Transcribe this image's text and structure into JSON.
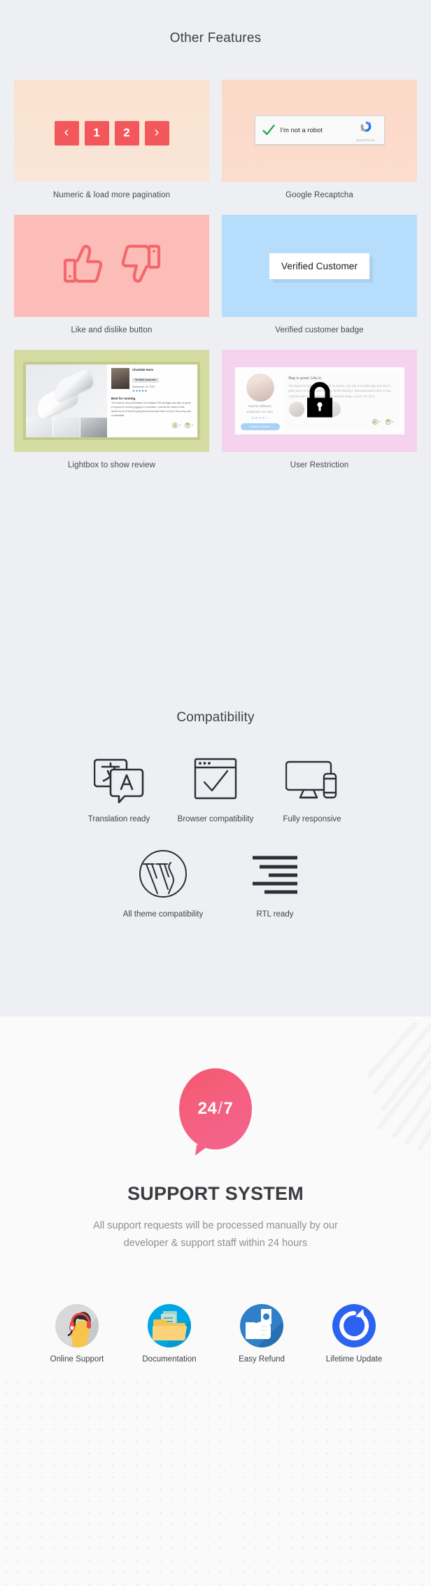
{
  "features": {
    "title": "Other Features",
    "cards": [
      {
        "caption": "Numeric & load more pagination",
        "art": "pagination",
        "pager": [
          "‹",
          "1",
          "2",
          "›"
        ]
      },
      {
        "caption": "Google Recaptcha",
        "art": "recaptcha",
        "recaptcha_label": "I'm not a robot",
        "recaptcha_brand": "reCAPTCHA"
      },
      {
        "caption": "Like and dislike button",
        "art": "like-dislike"
      },
      {
        "caption": "Verified customer badge",
        "art": "verified-badge",
        "badge_text": "Verified Customer"
      },
      {
        "caption": "Lightbox to show review",
        "art": "lightbox",
        "review": {
          "name": "Charlotte Haris",
          "badge": "Verified customer",
          "date": "September 19, 2021",
          "stars": "★★★★★",
          "title": "Best for running",
          "text": "The shoe is very comfortable and elegant.The package was also so good. It is good for running jogging or excercise. Love all the shoes of this brand.Go for it.Worth buying.Recommended other to buy.It Very cosy and comfortable.",
          "like_count": "0",
          "dislike_count": "0"
        }
      },
      {
        "caption": "User Restriction",
        "art": "user-restriction",
        "review": {
          "name": "Rachel Williams",
          "date": "September 19, 2021",
          "stars": "★★★★☆",
          "badge": "Verified customer",
          "title": "Bag is good. Like it.",
          "text": "The bag is so handy and looks is so classic, can use it occasionally and also in party too. It is so soft and elegant. Worth buying it. Recommended other to buy. Just buy one of the best product in internet today. Love it. Go for it.",
          "like_count": "0",
          "dislike_count": "0"
        }
      }
    ]
  },
  "compatibility": {
    "title": "Compatibility",
    "row1": [
      {
        "label": "Translation ready",
        "icon": "translate-icon",
        "letter": "A"
      },
      {
        "label": "Browser compatibility",
        "icon": "browser-check-icon"
      },
      {
        "label": "Fully responsive",
        "icon": "monitor-mobile-icon"
      }
    ],
    "row2": [
      {
        "label": "All theme compatibility",
        "icon": "wordpress-icon"
      },
      {
        "label": "RTL ready",
        "icon": "rtl-align-icon"
      }
    ]
  },
  "support": {
    "bubble_number": "24",
    "bubble_slash": "/",
    "bubble_days": "7",
    "title": "SUPPORT SYSTEM",
    "description": "All support requests will be processed manually by our developer & support staff within 24 hours",
    "items": [
      {
        "label": "Online Support",
        "icon": "headset-agent-icon",
        "color": "#d7d8da"
      },
      {
        "label": "Documentation",
        "icon": "folder-document-icon",
        "color": "#00a7e7"
      },
      {
        "label": "Easy Refund",
        "icon": "hand-money-icon",
        "color": "#2f7fc9"
      },
      {
        "label": "Lifetime Update",
        "icon": "refresh-circle-icon",
        "color": "#2b63f0"
      }
    ]
  },
  "colors": {
    "accent_red": "#f3575b",
    "page_bg": "#eeeff3",
    "support_bg": "#fafafa"
  }
}
